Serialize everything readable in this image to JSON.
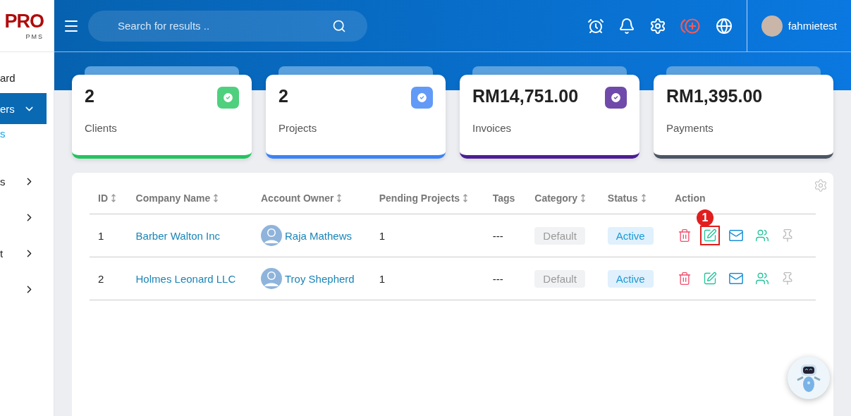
{
  "logo": {
    "name": "PRO",
    "tagline": "PMS"
  },
  "sidebar": {
    "items": [
      {
        "label": "ard",
        "selected": false,
        "kind": "plain"
      },
      {
        "label": "ers",
        "selected": true,
        "kind": "expanded"
      },
      {
        "label": "s",
        "selected": false,
        "kind": "sub"
      },
      {
        "label": "s",
        "selected": false,
        "kind": "collapsed"
      },
      {
        "selected": false,
        "kind": "collapsed"
      },
      {
        "label": "t",
        "selected": false,
        "kind": "collapsed"
      },
      {
        "selected": false,
        "kind": "collapsed"
      }
    ]
  },
  "search": {
    "placeholder": "Search for results .."
  },
  "user": {
    "name": "fahmietest"
  },
  "stats": [
    {
      "value": "2",
      "label": "Clients",
      "color": "#22c55e",
      "badge": true
    },
    {
      "value": "2",
      "label": "Projects",
      "color": "#3b82f6",
      "badge": true
    },
    {
      "value": "RM14,751.00",
      "label": "Invoices",
      "color": "#4c1d95",
      "badge": true
    },
    {
      "value": "RM1,395.00",
      "label": "Payments",
      "color": "#4b5563",
      "badge": false
    }
  ],
  "table": {
    "columns": [
      {
        "label": "ID",
        "sortable": true
      },
      {
        "label": "Company Name",
        "sortable": true
      },
      {
        "label": "Account Owner",
        "sortable": true
      },
      {
        "label": "Pending Projects",
        "sortable": true
      },
      {
        "label": "Tags",
        "sortable": false
      },
      {
        "label": "Category",
        "sortable": true
      },
      {
        "label": "Status",
        "sortable": true
      },
      {
        "label": "Action",
        "sortable": false
      }
    ],
    "rows": [
      {
        "id": "1",
        "company": "Barber Walton Inc",
        "owner": "Raja Mathews",
        "pending": "1",
        "tags": "---",
        "category": "Default",
        "status": "Active",
        "annotated": true
      },
      {
        "id": "2",
        "company": "Holmes Leonard LLC",
        "owner": "Troy Shepherd",
        "pending": "1",
        "tags": "---",
        "category": "Default",
        "status": "Active",
        "annotated": false
      }
    ]
  },
  "annotation_label": "1"
}
